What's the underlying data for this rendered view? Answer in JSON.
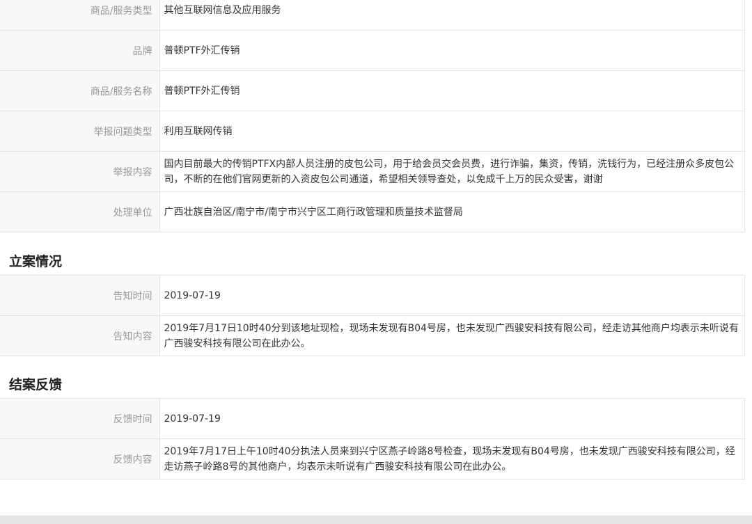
{
  "complaint_info": {
    "rows": [
      {
        "label": "商品/服务类型",
        "value": "其他互联网信息及应用服务"
      },
      {
        "label": "品牌",
        "value": "普顿PTF外汇传销"
      },
      {
        "label": "商品/服务名称",
        "value": "普顿PTF外汇传销"
      },
      {
        "label": "举报问题类型",
        "value": "利用互联网传销"
      },
      {
        "label": "举报内容",
        "value": "国内目前最大的传销PTFX内部人员注册的皮包公司，用于给会员交会员费，进行诈骗，集资，传销，洗钱行为，已经注册众多皮包公司，不断的在他们官网更新的入资皮包公司通道，希望相关领导查处，以免成千上万的民众受害，谢谢"
      },
      {
        "label": "处理单位",
        "value": "广西壮族自治区/南宁市/南宁市兴宁区工商行政管理和质量技术监督局"
      }
    ]
  },
  "case_filing": {
    "title": "立案情况",
    "rows": [
      {
        "label": "告知时间",
        "value": "2019-07-19"
      },
      {
        "label": "告知内容",
        "value": "2019年7月17日10时40分到该地址现检，现场未发现有B04号房，也未发现广西骏安科技有限公司，经走访其他商户均表示未听说有广西骏安科技有限公司在此办公。"
      }
    ]
  },
  "case_closing": {
    "title": "结案反馈",
    "rows": [
      {
        "label": "反馈时间",
        "value": "2019-07-19"
      },
      {
        "label": "反馈内容",
        "value": "2019年7月17日上午10时40分执法人员来到兴宁区燕子岭路8号检查，现场未发现有B04号房，也未发现广西骏安科技有限公司，经走访燕子岭路8号的其他商户，均表示未听说有广西骏安科技有限公司在此办公。"
      }
    ]
  }
}
